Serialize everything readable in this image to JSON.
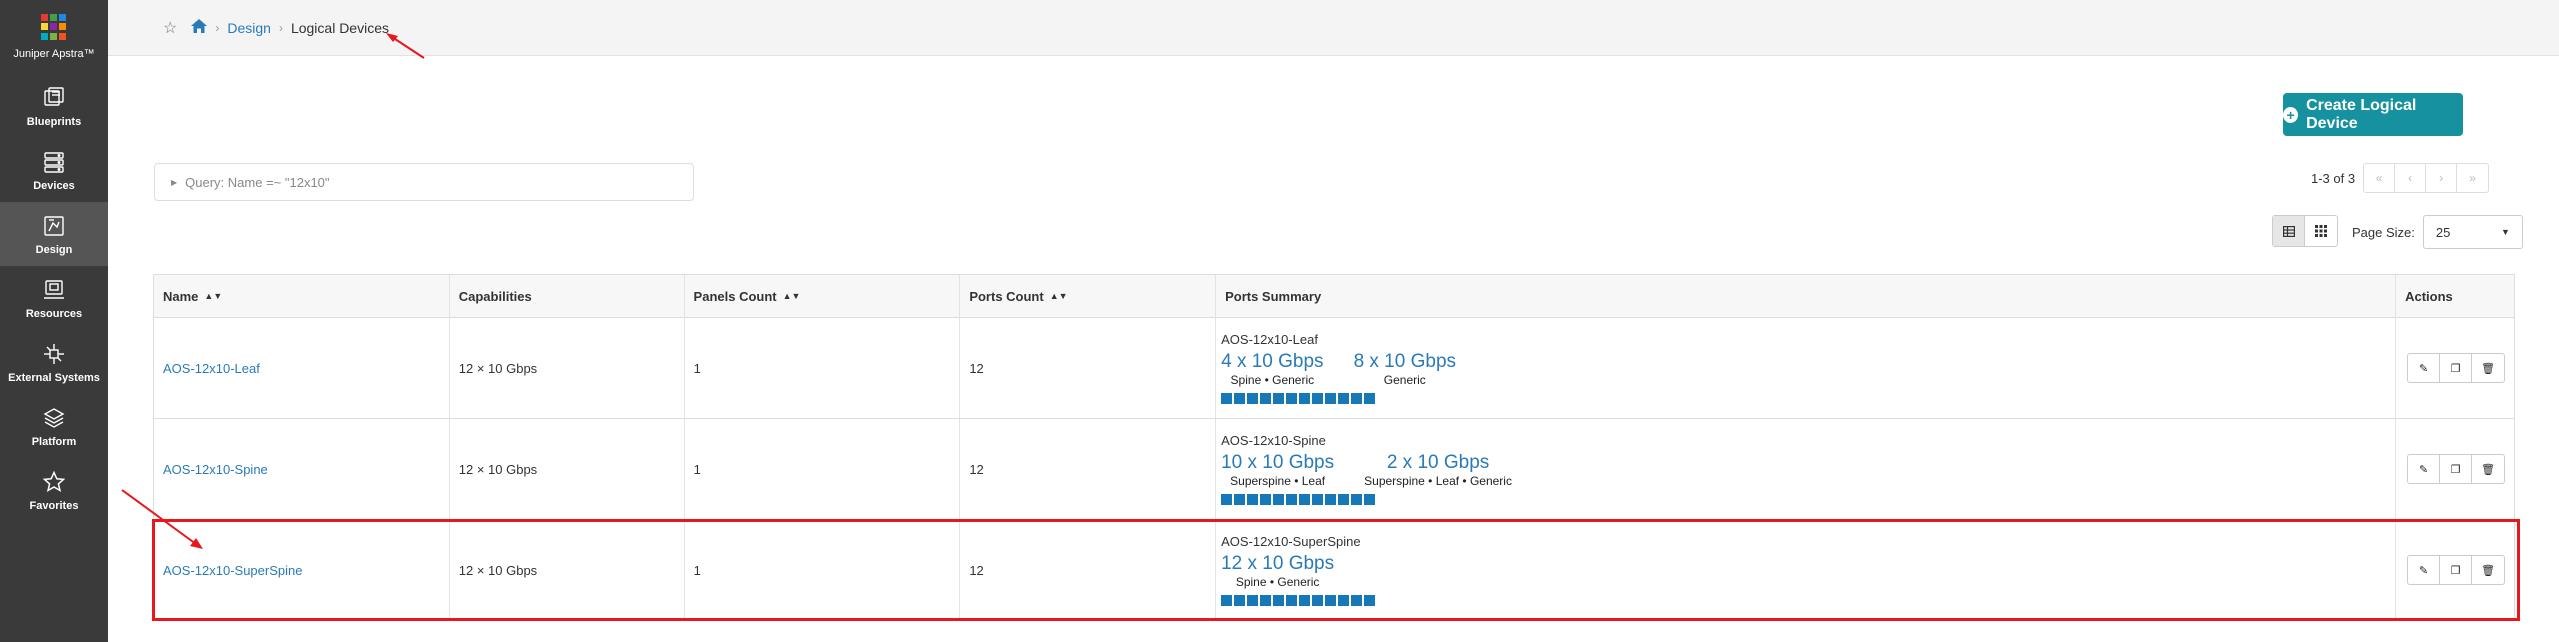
{
  "brand": {
    "name": "Juniper Apstra™",
    "logo_colors": [
      "#e53935",
      "#43a047",
      "#1e88e5",
      "#fdd835",
      "#8e24aa",
      "#fb8c00",
      "#00acc1",
      "#7cb342",
      "#f4511e"
    ]
  },
  "sidebar": {
    "items": [
      {
        "label": "Blueprints",
        "icon": "blueprints-icon"
      },
      {
        "label": "Devices",
        "icon": "devices-icon"
      },
      {
        "label": "Design",
        "icon": "design-icon",
        "active": true
      },
      {
        "label": "Resources",
        "icon": "resources-icon"
      },
      {
        "label": "External Systems",
        "icon": "external-systems-icon"
      },
      {
        "label": "Platform",
        "icon": "platform-icon"
      },
      {
        "label": "Favorites",
        "icon": "star-icon"
      }
    ]
  },
  "breadcrumb": {
    "section": "Design",
    "current": "Logical Devices"
  },
  "toolbar": {
    "create_label": "Create Logical Device",
    "query_text": "Query: Name =~ \"12x10\"",
    "pager_text": "1-3 of 3",
    "pager_buttons": [
      "«",
      "‹",
      "›",
      "»"
    ],
    "page_size_label": "Page Size:",
    "page_size_value": "25"
  },
  "table": {
    "headers": [
      "Name",
      "Capabilities",
      "Panels Count",
      "Ports Count",
      "Ports Summary",
      "Actions"
    ],
    "rows": [
      {
        "name": "AOS-12x10-Leaf",
        "capabilities": "12 × 10 Gbps",
        "panels": "1",
        "ports": "12",
        "summary_title": "AOS-12x10-Leaf",
        "groups": [
          {
            "count": "4 x 10 Gbps",
            "roles": "Spine • Generic"
          },
          {
            "count": "8 x 10 Gbps",
            "roles": "Generic"
          }
        ]
      },
      {
        "name": "AOS-12x10-Spine",
        "capabilities": "12 × 10 Gbps",
        "panels": "1",
        "ports": "12",
        "summary_title": "AOS-12x10-Spine",
        "groups": [
          {
            "count": "10 x 10 Gbps",
            "roles": "Superspine • Leaf"
          },
          {
            "count": "2 x 10 Gbps",
            "roles": "Superspine • Leaf • Generic"
          }
        ]
      },
      {
        "name": "AOS-12x10-SuperSpine",
        "capabilities": "12 × 10 Gbps",
        "panels": "1",
        "ports": "12",
        "summary_title": "AOS-12x10-SuperSpine",
        "groups": [
          {
            "count": "12 x 10 Gbps",
            "roles": "Spine • Generic"
          }
        ]
      }
    ]
  },
  "colors": {
    "accent": "#15919f",
    "link": "#2a7ab8",
    "port_square": "#1778b8",
    "annotation": "#e8161d",
    "sidebar_bg": "#3a3a3a"
  }
}
